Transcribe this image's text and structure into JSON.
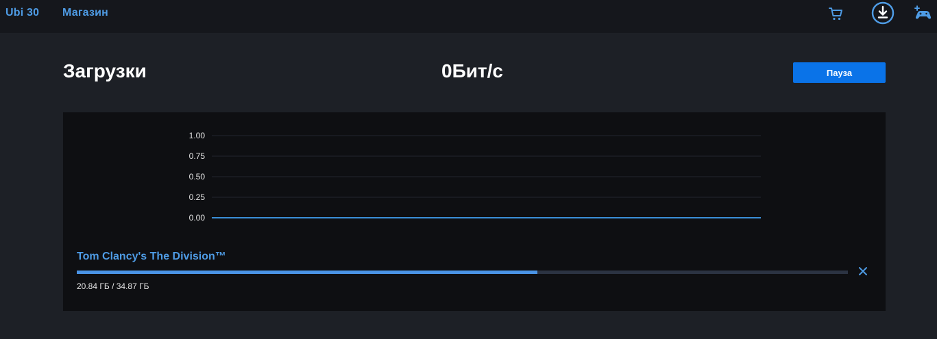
{
  "nav": {
    "brand": "Ubi 30",
    "store": "Магазин",
    "icons": [
      "cart-icon",
      "download-icon",
      "gamepad-icon"
    ],
    "accent": "#4e9be4"
  },
  "header": {
    "title": "Загрузки",
    "speed": "0Бит/с",
    "pause_label": "Пауза",
    "pause_color": "#0a73e8"
  },
  "chart_data": {
    "type": "line",
    "title": "",
    "xlabel": "",
    "ylabel": "",
    "ylim": [
      0,
      1
    ],
    "y_ticks": [
      "1.00",
      "0.75",
      "0.50",
      "0.25",
      "0.00"
    ],
    "grid": true,
    "series": [
      {
        "values": [
          0,
          0
        ],
        "color": "#3a8fd8"
      }
    ]
  },
  "download": {
    "game": "Tom Clancy's The Division™",
    "size_text": "20.84 ГБ / 34.87 ГБ",
    "downloaded_gb": 20.84,
    "total_gb": 34.87,
    "cancel_icon": "close-icon"
  }
}
